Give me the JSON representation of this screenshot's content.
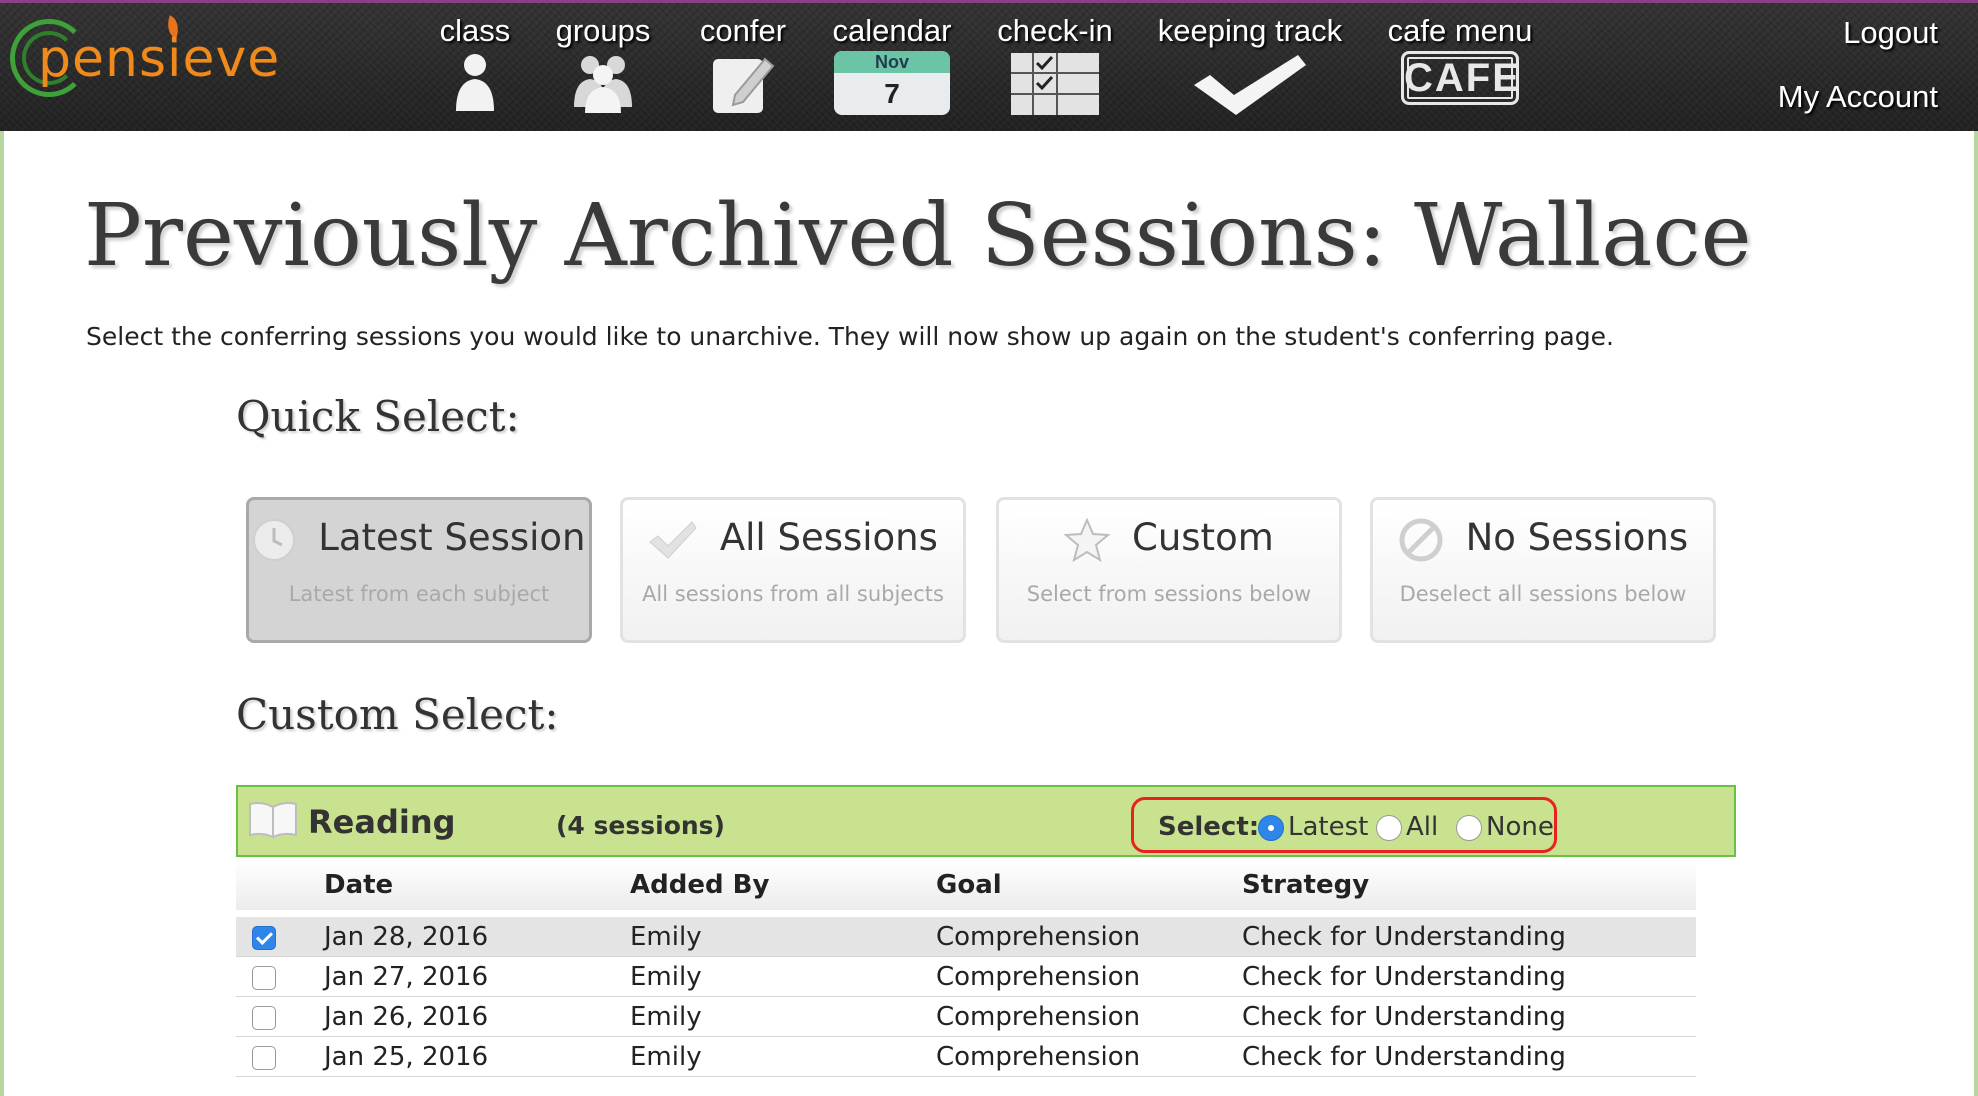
{
  "brand": {
    "logo_text": "pensieve"
  },
  "nav": {
    "items": [
      {
        "label": "class"
      },
      {
        "label": "groups"
      },
      {
        "label": "confer"
      },
      {
        "label": "calendar",
        "month": "Nov",
        "day": "7"
      },
      {
        "label": "check-in"
      },
      {
        "label": "keeping track"
      },
      {
        "label": "cafe menu",
        "icon_text": "CAFE"
      }
    ],
    "logout": "Logout",
    "my_account": "My Account"
  },
  "page": {
    "title": "Previously Archived Sessions: Wallace",
    "instructions": "Select the conferring sessions you would like to unarchive. They will now show up again on the student's conferring page."
  },
  "quick_select": {
    "heading": "Quick Select:",
    "options": [
      {
        "title": "Latest Session",
        "subtitle": "Latest from each subject",
        "icon": "clock-icon",
        "active": true
      },
      {
        "title": "All Sessions",
        "subtitle": "All sessions from all subjects",
        "icon": "checkmark-icon",
        "active": false
      },
      {
        "title": "Custom",
        "subtitle": "Select from sessions below",
        "icon": "star-icon",
        "active": false
      },
      {
        "title": "No Sessions",
        "subtitle": "Deselect all sessions below",
        "icon": "no-symbol-icon",
        "active": false
      }
    ]
  },
  "custom_select": {
    "heading": "Custom Select:",
    "subject": {
      "name": "Reading",
      "count": "(4 sessions)",
      "icon": "book-icon",
      "select_label": "Select:",
      "radio_options": [
        "Latest",
        "All",
        "None"
      ],
      "selected_option": "Latest"
    },
    "columns": [
      "Date",
      "Added By",
      "Goal",
      "Strategy"
    ],
    "rows": [
      {
        "checked": true,
        "date": "Jan 28, 2016",
        "added_by": "Emily",
        "goal": "Comprehension",
        "strategy": "Check for Understanding"
      },
      {
        "checked": false,
        "date": "Jan 27, 2016",
        "added_by": "Emily",
        "goal": "Comprehension",
        "strategy": "Check for Understanding"
      },
      {
        "checked": false,
        "date": "Jan 26, 2016",
        "added_by": "Emily",
        "goal": "Comprehension",
        "strategy": "Check for Understanding"
      },
      {
        "checked": false,
        "date": "Jan 25, 2016",
        "added_by": "Emily",
        "goal": "Comprehension",
        "strategy": "Check for Understanding"
      }
    ]
  },
  "colors": {
    "nav_bg": "#2b2b2b",
    "logo_green": "#3ea13a",
    "logo_orange": "#f08a1c",
    "subject_bar": "#c9e28f",
    "subject_border": "#6abf45",
    "highlight_red": "#e8231f",
    "radio_blue": "#2f86ea"
  }
}
